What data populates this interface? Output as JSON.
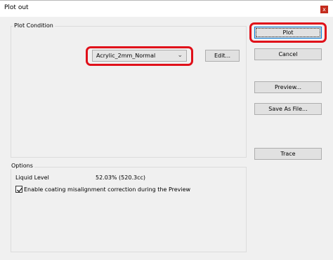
{
  "window": {
    "title": "Plot out",
    "close_glyph": "x"
  },
  "plot_condition": {
    "group_label": "Plot Condition",
    "selected_profile": "Acrylic_2mm_Normal",
    "edit_label": "Edit..."
  },
  "buttons": {
    "plot": "Plot",
    "cancel": "Cancel",
    "preview": "Preview...",
    "save_as_file": "Save As File...",
    "trace": "Trace"
  },
  "options": {
    "group_label": "Options",
    "liquid_level_label": "Liquid Level",
    "liquid_level_value": "52.03% (520.3cc)",
    "coating_correction_label": "Enable coating misalignment correction during the Preview",
    "coating_correction_checked": true
  },
  "colors": {
    "highlight": "#e0101a",
    "default_border": "#0078d7",
    "close_bg": "#c42b1c"
  }
}
